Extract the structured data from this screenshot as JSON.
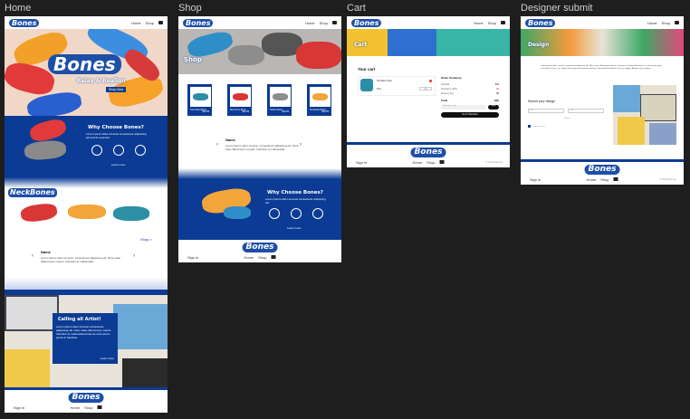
{
  "frames": {
    "home": "Home",
    "shop": "Shop",
    "cart": "Cart",
    "designer": "Designer submit"
  },
  "brand": {
    "logo": "Bones",
    "accent": "#0b3b94",
    "logo_bg": "#1d4fa8",
    "canvas_bg": "#1e1e1e"
  },
  "nav": {
    "home": "Home",
    "shop": "Shop",
    "cart_icon": "cart-icon"
  },
  "home": {
    "hero_title": "Bones",
    "hero_subtitle": "Relax & Realign",
    "hero_button": "Shop Now",
    "why_title": "Why Choose Bones?",
    "why_text": "Lorem ipsum dolor sit amet consectetur adipiscing elit sed do eiusmod.",
    "learn_more": "Learn more",
    "neckbones_title": "NeckBones",
    "shop_link": "Shop >",
    "review_name": "Name",
    "review_text": "Lorem ipsum dolor sit amet, consectetur adipiscing elit. Nunc vitae ullamcorper mauris. Interdum et malesuada.",
    "artist_title": "Calling all Artist!",
    "artist_text": "Lorem ipsum dolor sit amet consectetur adipiscing elit. Nunc vitae ullamcorper mauris. Interdum et malesuada fames ac ante ipsum primis in faucibus.",
    "artist_link": "Learn more"
  },
  "shop": {
    "hero_title": "Shop",
    "products": [
      {
        "label": "Cool Wool Bone",
        "price": "$29.99"
      },
      {
        "label": "Red Ferry Bone",
        "price": "$29.99"
      },
      {
        "label": "Hellion Bone",
        "price": "$29.99"
      },
      {
        "label": "Sunkissed Bone",
        "price": "$29.99"
      }
    ],
    "review_name": "Name",
    "review_text": "Lorem ipsum dolor sit amet, consectetur adipiscing elit. Nunc vitae ullamcorper mauris. Interdum et malesuada.",
    "why_title": "Why Choose Bones?",
    "why_text": "Lorem ipsum dolor sit amet consectetur adipiscing elit.",
    "learn_more": "Learn more"
  },
  "cart": {
    "hero_title": "Cart",
    "your_cart": "Your cart",
    "item1": "NeckBone Blue",
    "item2": "Kids",
    "summary_title": "Order Summary",
    "rows": [
      {
        "label": "Subtotal",
        "value": "$44"
      },
      {
        "label": "Discount (-20%)",
        "value": "-$9"
      },
      {
        "label": "Delivery Fee",
        "value": "$5"
      }
    ],
    "total_label": "Total",
    "total_value": "$40",
    "promo_placeholder": "Add promo code",
    "apply": "Apply",
    "checkout": "Go to Checkout"
  },
  "designer": {
    "hero_title": "Design",
    "intro": "Lorem ipsum dolor sit amet, consectetur adipiscing elit. Nunc vitae ullamcorper mauris. Interdum et malesuada fames ac ante ipsum primis in faucibus. Donec nec neque vitae magna fermentum interdum. Sed gravida tincidunt arcu non sagittis. Aliquam erat volutpat.",
    "submit_title": "Submit your design",
    "first_name": "First",
    "last_name": "Last",
    "email": "Email",
    "upload": "Upload",
    "agree": "I agree to terms"
  },
  "footer": {
    "sign": "Sign in",
    "home": "Home",
    "shop": "Shop",
    "copy": "© 2024 Bones"
  }
}
